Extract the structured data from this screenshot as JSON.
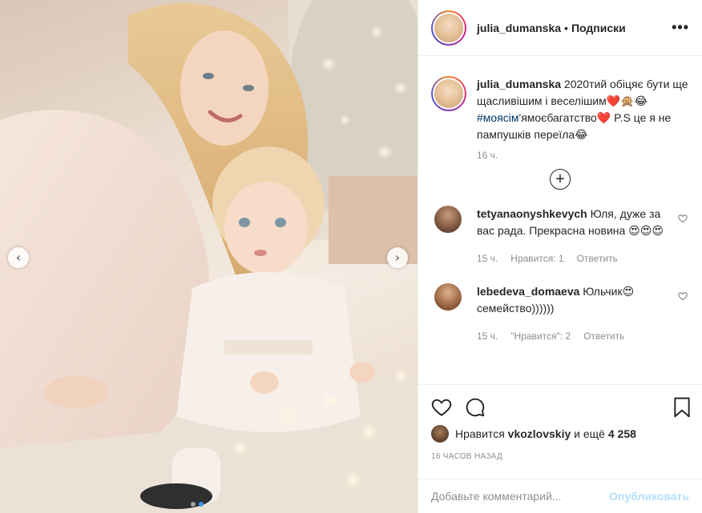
{
  "header": {
    "username": "julia_dumanska",
    "separator": "•",
    "follow_label": "Подписки",
    "more_label": "•••"
  },
  "caption": {
    "username": "julia_dumanska",
    "text_1": " 2020тий обіцяє бути ще щасливішим і веселішим❤️🙊😂 ",
    "hashtag": "#моясім",
    "text_2": "'ямоєбагатство❤️ P.S це я не пампушків переїла😂",
    "time": "16 ч."
  },
  "load_more_label": "+",
  "comments": [
    {
      "username": "tetyanaonyshkevych",
      "text": " Юля, дуже за вас рада. Прекрасна новина 😍😍😍",
      "time": "15 ч.",
      "likes": "Нравится: 1",
      "reply": "Ответить"
    },
    {
      "username": "lebedeva_domaeva",
      "text": " Юльчик😍 семейство))))))",
      "time": "15 ч.",
      "likes": "\"Нравится\": 2",
      "reply": "Ответить"
    }
  ],
  "likes": {
    "prefix": "Нравится ",
    "user": "vkozlovskiy",
    "middle": " и ещё ",
    "count": "4 258"
  },
  "post_age": "16 ЧАСОВ НАЗАД",
  "add_comment": {
    "placeholder": "Добавьте комментарий...",
    "publish_label": "Опубликовать"
  },
  "carousel": {
    "prev": "‹",
    "next": "›",
    "slide_count": 2,
    "active_slide": 2
  },
  "colors": {
    "accent": "#3897f0",
    "link": "#00376b",
    "muted": "#8e8e8e",
    "publish_disabled": "#b2dffc",
    "like_heart": "#ed4956"
  },
  "icons": {
    "like": "heart-icon",
    "comment": "comment-icon",
    "save": "bookmark-icon",
    "comment_like": "heart-outline-icon"
  }
}
